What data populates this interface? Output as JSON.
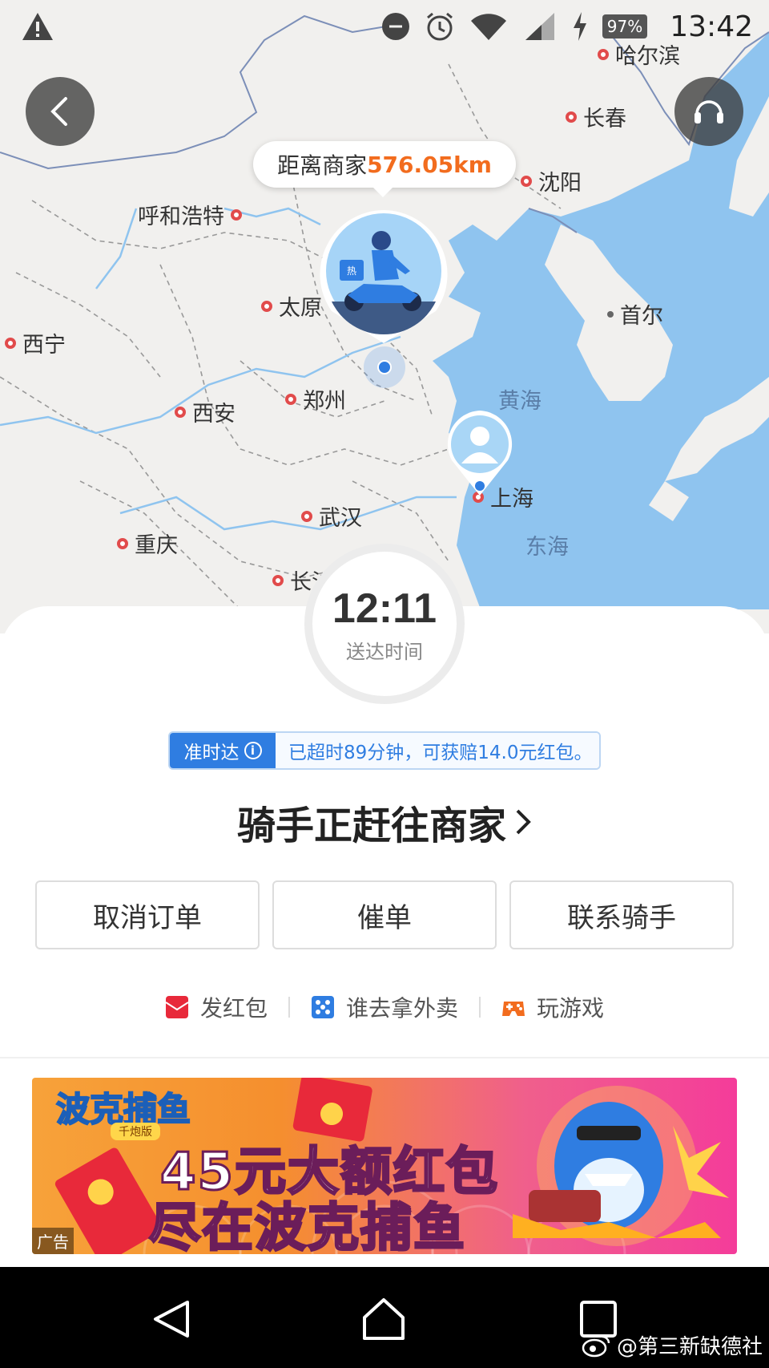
{
  "status_bar": {
    "time": "13:42",
    "battery": "97%"
  },
  "map": {
    "cities": [
      {
        "name": "哈尔滨"
      },
      {
        "name": "长春"
      },
      {
        "name": "沈阳"
      },
      {
        "name": "呼和浩特"
      },
      {
        "name": "太原"
      },
      {
        "name": "首尔"
      },
      {
        "name": "西宁"
      },
      {
        "name": "郑州"
      },
      {
        "name": "西安"
      },
      {
        "name": "上海"
      },
      {
        "name": "武汉"
      },
      {
        "name": "重庆"
      },
      {
        "name": "长沙"
      }
    ],
    "seas": [
      {
        "name": "黄海"
      },
      {
        "name": "东海"
      }
    ],
    "distance_label": "距离商家",
    "distance_value": "576.05km",
    "rider_badge": "热"
  },
  "eta": {
    "time": "12:11",
    "label": "送达时间"
  },
  "ontime": {
    "tag": "准时达",
    "info_icon": "i",
    "message": "已超时89分钟，可获赔14.0元红包。"
  },
  "status_title": "骑手正赶往商家",
  "actions": {
    "cancel": "取消订单",
    "urge": "催单",
    "contact": "联系骑手"
  },
  "links": {
    "red_packet": "发红包",
    "who_pickup": "谁去拿外卖",
    "game": "玩游戏"
  },
  "ad": {
    "logo": "波克捕鱼",
    "logo_sub": "千炮版",
    "line1": "45元大额红包",
    "line2": "尽在波克捕鱼",
    "badge": "广告"
  },
  "watermark": "@第三新缺德社",
  "colors": {
    "accent_blue": "#2f7de1",
    "distance_orange": "#f26c1e",
    "city_dot": "#e14b4b",
    "sea": "#8fc4ef"
  },
  "icons": [
    "warning-icon",
    "sync-icon",
    "alarm-icon",
    "wifi-icon",
    "signal-icon",
    "charging-icon",
    "back-icon",
    "headset-icon",
    "rider-scooter-icon",
    "user-avatar-icon",
    "info-icon",
    "chevron-right-icon",
    "red-packet-icon",
    "dice-icon",
    "gamepad-icon",
    "nav-back-icon",
    "nav-home-icon",
    "nav-recents-icon",
    "weibo-icon"
  ]
}
